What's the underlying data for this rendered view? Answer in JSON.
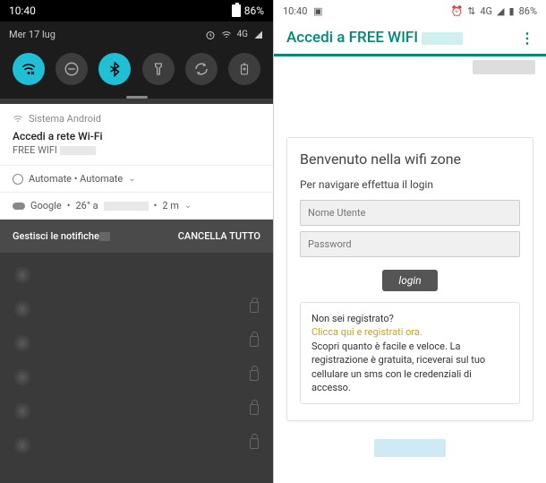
{
  "left": {
    "status": {
      "time": "10:40",
      "battery": "86%"
    },
    "qs": {
      "date": "Mer 17 lug",
      "icons_label": "4G"
    },
    "notif_wifi": {
      "app": "Sistema Android",
      "title": "Accedi a rete Wi-Fi",
      "body": "FREE WIFI"
    },
    "automate": {
      "label": "Automate • Automate"
    },
    "google": {
      "label": "Google",
      "temp": "26° a",
      "dist": "2 m"
    },
    "actions": {
      "manage": "Gestisci le notifiche",
      "clear": "CANCELLA TUTTO"
    }
  },
  "right": {
    "status": {
      "time": "10:40",
      "net": "4G",
      "battery": "86%"
    },
    "appbar": {
      "title": "Accedi a FREE WIFI"
    },
    "login": {
      "heading": "Benvenuto nella wifi zone",
      "sub": "Per navigare effettua il login",
      "user_placeholder": "Nome Utente",
      "pass_placeholder": "Password",
      "button": "login"
    },
    "register": {
      "q": "Non sei registrato?",
      "link": "Clicca qui e registrati ora.",
      "desc": "Scopri quanto è facile e veloce. La registrazione è gratuita, riceverai sul tuo cellulare un sms con le credenziali di accesso."
    }
  }
}
